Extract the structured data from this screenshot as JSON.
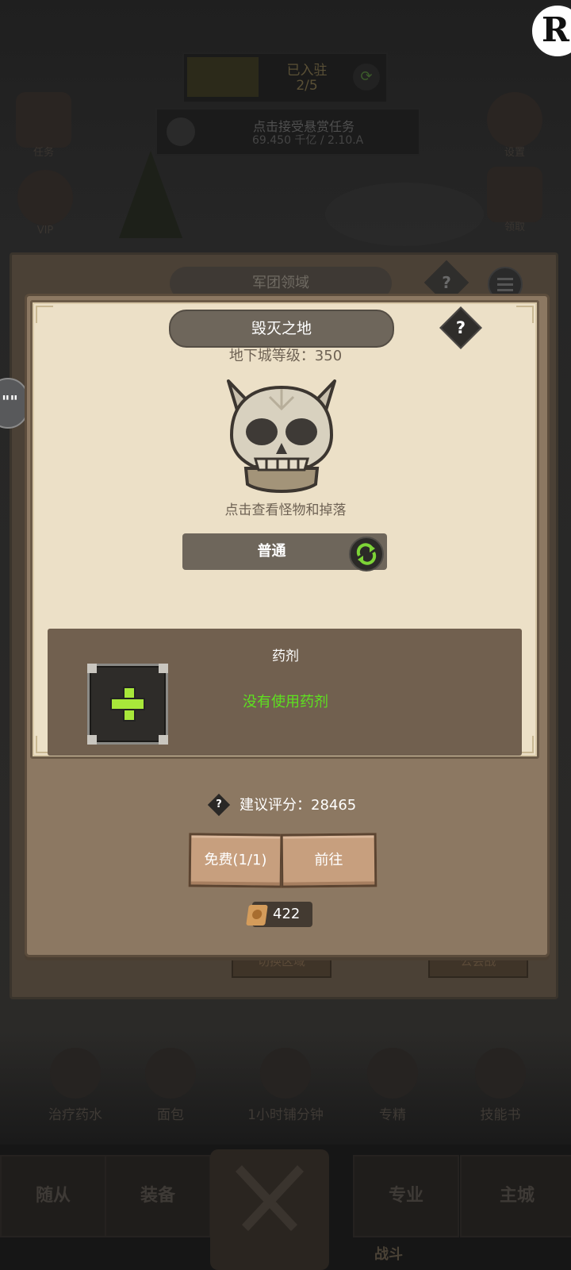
{
  "background": {
    "top_progress": {
      "label": "已入驻",
      "value": "2/5"
    },
    "task_banner": {
      "text": "点击接受悬赏任务",
      "sub": "69.450 千亿 / 2.10.A"
    },
    "left_icons": [
      {
        "label": "任务"
      },
      {
        "label": "VIP"
      }
    ],
    "right_icons": [
      {
        "label": "设置"
      },
      {
        "label": "领取"
      }
    ],
    "panel_title": "军团领域",
    "panel_help": "?",
    "bg_buttons": [
      "切换区域",
      "公会战"
    ],
    "items": [
      {
        "label": "治疗药水"
      },
      {
        "label": "面包"
      },
      {
        "label": "1小时铺分钟"
      },
      {
        "label": "专精"
      },
      {
        "label": "技能书"
      }
    ],
    "nav": {
      "left1": "随从",
      "left2": "装备",
      "center": "战斗",
      "right1": "专业",
      "right2": "主城"
    }
  },
  "overlay": {
    "right_badge": "R",
    "left_tab": "\"\""
  },
  "dialog": {
    "title": "毁灭之地",
    "help": "?",
    "level_label": "地下城等级：350",
    "hint": "点击查看怪物和掉落",
    "mode": "普通",
    "potion": {
      "title": "药剂",
      "status": "没有使用药剂"
    },
    "rating_help": "?",
    "rating": "建议评分：28465",
    "free_button": "免费(1/1)",
    "go_button": "前往",
    "scroll_count": "422"
  },
  "colors": {
    "panel": "#8c7862",
    "inner": "#ece0c7",
    "potion_box": "#71604f",
    "status_green": "#5de21f",
    "plus_green": "#a8e83a",
    "button_wood": "#c79f7e"
  },
  "icons": {
    "skull": "skull-icon",
    "refresh": "refresh-icon",
    "add": "plus-icon",
    "scroll": "scroll-icon",
    "help": "question-icon"
  }
}
